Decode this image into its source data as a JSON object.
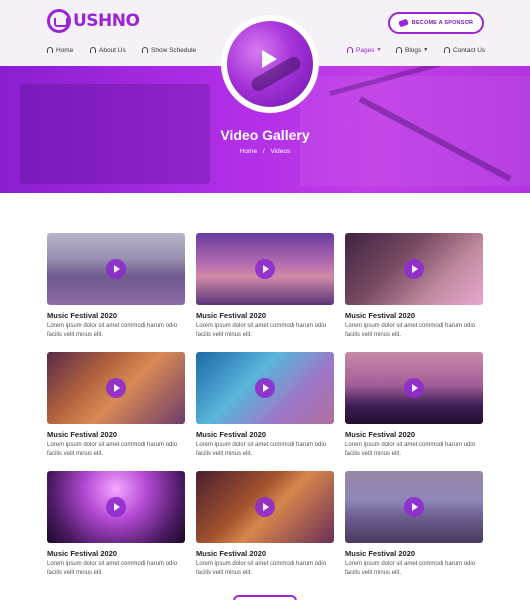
{
  "brand": {
    "name": "USHNO"
  },
  "header": {
    "sponsor_label": "BECOME A SPONSOR",
    "nav": [
      {
        "label": "Home",
        "icon": "headphones-icon",
        "active": false
      },
      {
        "label": "About Us",
        "icon": "headphones-icon",
        "active": false
      },
      {
        "label": "Show Schedule",
        "icon": "headphones-icon",
        "active": false
      },
      {
        "label": "Pages",
        "icon": "headphones-icon",
        "active": true,
        "dropdown": true
      },
      {
        "label": "Blogs",
        "icon": "headphones-icon",
        "active": false,
        "dropdown": true
      },
      {
        "label": "Contact Us",
        "icon": "headphones-icon",
        "active": false
      }
    ]
  },
  "hero": {
    "title": "Video Gallery",
    "breadcrumb": {
      "home": "Home",
      "separator": "/",
      "current": "Videos"
    }
  },
  "gallery": {
    "items": [
      {
        "title": "Music Festival 2020",
        "desc": "Lorem ipsum dolor sit amet commodi harum odio facilis velit minus elit."
      },
      {
        "title": "Music Festival 2020",
        "desc": "Lorem ipsum dolor sit amet commodi harum odio facilis velit minus elit."
      },
      {
        "title": "Music Festival 2020",
        "desc": "Lorem ipsum dolor sit amet commodi harum odio facilis velit minus elit."
      },
      {
        "title": "Music Festival 2020",
        "desc": "Lorem ipsum dolor sit amet commodi harum odio facilis velit minus elit."
      },
      {
        "title": "Music Festival 2020",
        "desc": "Lorem ipsum dolor sit amet commodi harum odio facilis velit minus elit."
      },
      {
        "title": "Music Festival 2020",
        "desc": "Lorem ipsum dolor sit amet commodi harum odio facilis velit minus elit."
      },
      {
        "title": "Music Festival 2020",
        "desc": "Lorem ipsum dolor sit amet commodi harum odio facilis velit minus elit."
      },
      {
        "title": "Music Festival 2020",
        "desc": "Lorem ipsum dolor sit amet commodi harum odio facilis velit minus elit."
      },
      {
        "title": "Music Festival 2020",
        "desc": "Lorem ipsum dolor sit amet commodi harum odio facilis velit minus elit."
      }
    ]
  },
  "colors": {
    "accent": "#9b24d6",
    "hero_start": "#8a1fd0",
    "hero_end": "#c13de6"
  }
}
